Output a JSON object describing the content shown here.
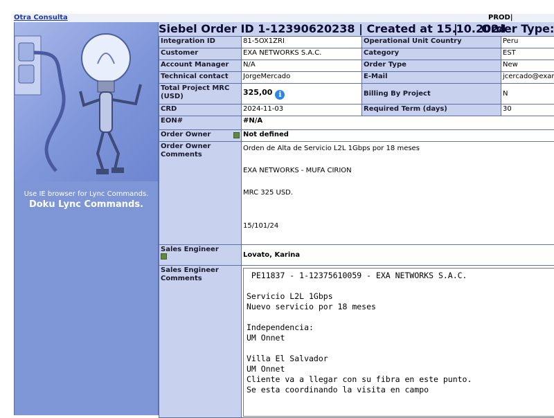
{
  "top": {
    "link": "Otra Consulta",
    "env": "PROD|"
  },
  "sidebar": {
    "note": "Use IE browser for Lync Commands.",
    "title": "Doku Lync Commands."
  },
  "header": {
    "part1": "Siebel Order ID 1-12390620238 | Created at 15.10.2024",
    "part2": "|",
    "part3": "Order Type: N"
  },
  "rows": {
    "integration_id_label": "Integration ID",
    "integration_id": "81-5OX1ZRI",
    "ouc_label": "Operational Unit Country",
    "ouc": "Peru",
    "customer_label": "Customer",
    "customer": "EXA NETWORKS S.A.C.",
    "category_label": "Category",
    "category": "EST",
    "am_label": "Account Manager",
    "am": "N/A",
    "order_type_label": "Order Type",
    "order_type": "New",
    "tech_label": "Technical contact",
    "tech": "JorgeMercado",
    "email_label": "E-Mail",
    "email": "jcercado@exan",
    "mrc_label": "Total Project MRC (USD)",
    "mrc": "325,00",
    "billing_label": "Billing By Project",
    "billing": "N",
    "crd_label": "CRD",
    "crd": "2024-11-03",
    "term_label": "Required Term (days)",
    "term": "30",
    "eon_label": "EON#",
    "eon": "#N/A",
    "owner_label": "Order Owner",
    "owner": "Not defined",
    "owner_comments_label": "Order Owner Comments",
    "owner_comments": [
      "Orden de Alta de Servicio L2L 1Gbps por 18 meses",
      "EXA NETWORKS - MUFA CIRION",
      "MRC 325 USD.",
      "15/101/24"
    ],
    "se_label": "Sales Engineer",
    "se": "Lovato, Karina",
    "se_comments_label": "Sales Engineer Comments",
    "se_comments": " PE11837 - 1-12375610059 - EXA NETWORKS S.A.C.\n\nServicio L2L 1Gbps\nNuevo servicio por 18 meses\n\nIndependencia:\nUM Onnet\n\nVilla El Salvador\nUM Onnet\nCliente va a llegar con su fibra en este punto.\nSe esta coordinando la visita en campo"
  },
  "icons": {
    "info": "info-icon",
    "menu": "menu-icon"
  },
  "colors": {
    "label_bg": "#c8d2ee",
    "sidebar_bg": "#7e95d6",
    "info_blue": "#2a86e8",
    "link": "#1f3aa8"
  }
}
